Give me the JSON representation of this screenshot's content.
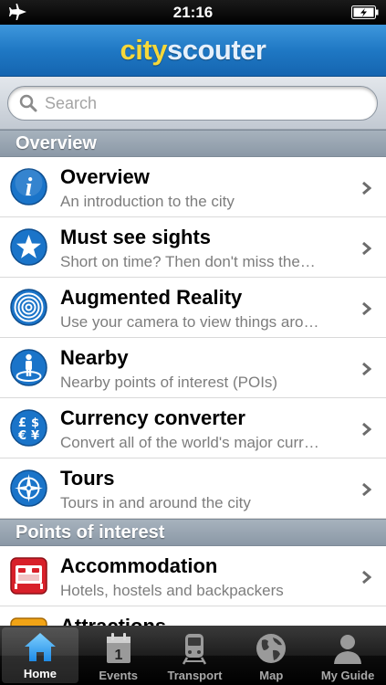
{
  "status_bar": {
    "time": "21:16"
  },
  "app": {
    "logo_part1": "city",
    "logo_part2": "scouter"
  },
  "search": {
    "placeholder": "Search"
  },
  "sections": [
    {
      "header": "Overview",
      "items": [
        {
          "title": "Overview",
          "subtitle": "An introduction to the city",
          "icon": "info-icon"
        },
        {
          "title": "Must see sights",
          "subtitle": "Short on time? Then don't miss the…",
          "icon": "star-icon"
        },
        {
          "title": "Augmented Reality",
          "subtitle": "Use your camera to view things aro…",
          "icon": "target-rings-icon"
        },
        {
          "title": "Nearby",
          "subtitle": "Nearby points of interest (POIs)",
          "icon": "person-nearby-icon"
        },
        {
          "title": "Currency converter",
          "subtitle": "Convert all of the world's major curr…",
          "icon": "currency-icon"
        },
        {
          "title": "Tours",
          "subtitle": "Tours in and around the city",
          "icon": "compass-icon"
        }
      ]
    },
    {
      "header": "Points of interest",
      "items": [
        {
          "title": "Accommodation",
          "subtitle": "Hotels, hostels and backpackers",
          "icon": "bed-icon"
        },
        {
          "title": "Attractions",
          "subtitle": "",
          "icon": "attractions-icon"
        }
      ]
    }
  ],
  "tabs": [
    {
      "label": "Home",
      "icon": "home-icon",
      "active": true
    },
    {
      "label": "Events",
      "icon": "calendar-icon",
      "active": false
    },
    {
      "label": "Transport",
      "icon": "train-icon",
      "active": false
    },
    {
      "label": "Map",
      "icon": "globe-icon",
      "active": false
    },
    {
      "label": "My Guide",
      "icon": "person-icon",
      "active": false
    }
  ],
  "colors": {
    "nav_blue": "#1f78c4",
    "logo_yellow": "#f6d83a",
    "icon_blue": "#1a74c9",
    "accommodation_red": "#d8202a"
  }
}
